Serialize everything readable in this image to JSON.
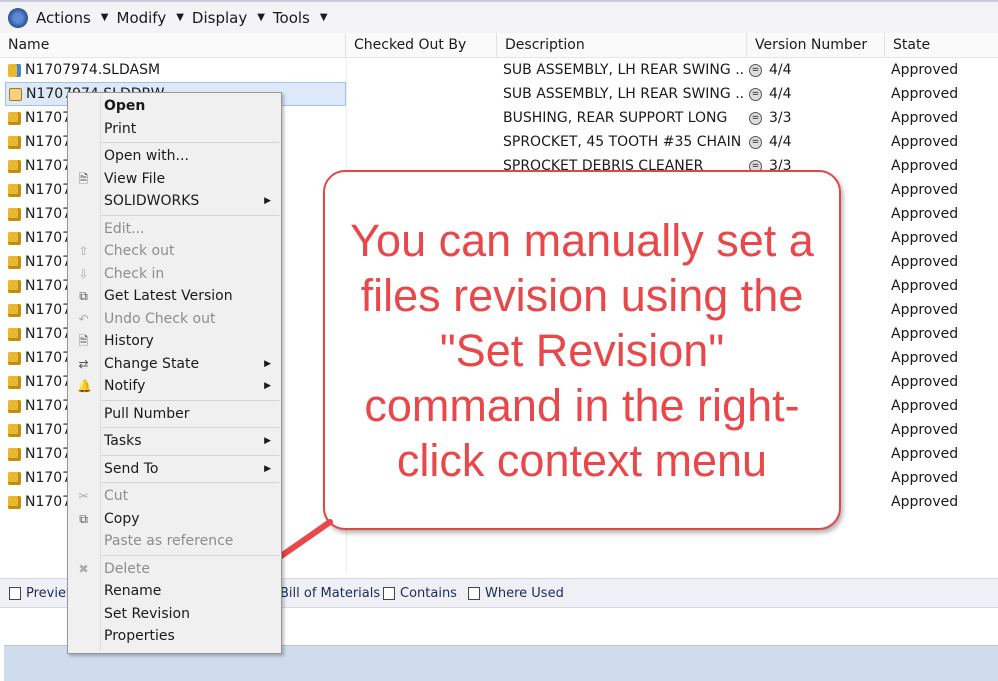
{
  "toolbar": {
    "menus": [
      "Actions",
      "Modify",
      "Display",
      "Tools"
    ]
  },
  "columns": [
    "Name",
    "Checked Out By",
    "Description",
    "Version Number",
    "State"
  ],
  "rows": [
    {
      "name": "N1707974.SLDASM",
      "type": "asm",
      "desc": "SUB ASSEMBLY, LH REAR SWING ...",
      "ver": "4/4",
      "state": "Approved"
    },
    {
      "name": "N1707974.SLDDRW",
      "type": "drw",
      "desc": "SUB ASSEMBLY, LH REAR SWING ...",
      "ver": "4/4",
      "state": "Approved",
      "selected": true
    },
    {
      "name": "N1707",
      "type": "prt",
      "desc": "BUSHING, REAR SUPPORT LONG",
      "ver": "3/3",
      "state": "Approved"
    },
    {
      "name": "N1707",
      "type": "prt",
      "desc": "SPROCKET, 45 TOOTH #35 CHAIN",
      "ver": "4/4",
      "state": "Approved"
    },
    {
      "name": "N1707",
      "type": "prt",
      "desc": "SPROCKET DEBRIS CLEANER",
      "ver": "3/3",
      "state": "Approved"
    },
    {
      "name": "N1707",
      "type": "prt",
      "state": "Approved"
    },
    {
      "name": "N1707",
      "type": "prt",
      "state": "Approved"
    },
    {
      "name": "N1707",
      "type": "prt",
      "state": "Approved"
    },
    {
      "name": "N1707",
      "type": "prt",
      "state": "Approved"
    },
    {
      "name": "N1707",
      "type": "prt",
      "state": "Approved"
    },
    {
      "name": "N1707",
      "type": "prt",
      "state": "Approved"
    },
    {
      "name": "N1707",
      "type": "prt",
      "state": "Approved"
    },
    {
      "name": "N1707",
      "type": "prt",
      "state": "Approved"
    },
    {
      "name": "N1707",
      "type": "prt",
      "state": "Approved"
    },
    {
      "name": "N1707",
      "type": "prt",
      "state": "Approved"
    },
    {
      "name": "N1707",
      "type": "prt",
      "state": "Approved"
    },
    {
      "name": "N1707",
      "type": "prt",
      "state": "Approved"
    },
    {
      "name": "N1707",
      "type": "prt",
      "state": "Approved"
    },
    {
      "name": "N1707",
      "type": "prt",
      "state": "Approved"
    }
  ],
  "context_menu": [
    {
      "label": "Open",
      "bold": true
    },
    {
      "label": "Print"
    },
    {
      "sep": true
    },
    {
      "label": "Open with..."
    },
    {
      "label": "View File",
      "icon": "view-file-icon"
    },
    {
      "label": "SOLIDWORKS",
      "submenu": true
    },
    {
      "sep": true
    },
    {
      "label": "Edit...",
      "disabled": true
    },
    {
      "label": "Check out",
      "disabled": true,
      "icon": "check-out-icon"
    },
    {
      "label": "Check in",
      "disabled": true,
      "icon": "check-in-icon"
    },
    {
      "label": "Get Latest Version",
      "icon": "get-latest-icon"
    },
    {
      "label": "Undo Check out",
      "disabled": true,
      "icon": "undo-icon"
    },
    {
      "label": "History",
      "icon": "history-icon"
    },
    {
      "label": "Change State",
      "submenu": true,
      "icon": "workflow-icon"
    },
    {
      "label": "Notify",
      "submenu": true,
      "icon": "bell-icon"
    },
    {
      "sep": true
    },
    {
      "label": "Pull Number"
    },
    {
      "sep": true
    },
    {
      "label": "Tasks",
      "submenu": true
    },
    {
      "sep": true
    },
    {
      "label": "Send To",
      "submenu": true
    },
    {
      "sep": true
    },
    {
      "label": "Cut",
      "disabled": true,
      "icon": "scissors-icon"
    },
    {
      "label": "Copy",
      "icon": "copy-icon"
    },
    {
      "label": "Paste as reference",
      "disabled": true
    },
    {
      "sep": true
    },
    {
      "label": "Delete",
      "disabled": true,
      "icon": "delete-icon"
    },
    {
      "label": "Rename"
    },
    {
      "label": "Set Revision"
    },
    {
      "label": "Properties"
    }
  ],
  "tabs": [
    "Preview",
    "Bill of Materials",
    "Contains",
    "Where Used"
  ],
  "callout": {
    "text": "You can manually set a files revision using the \"Set Revision\" command in the right-click context menu",
    "color": "#e8484a"
  }
}
